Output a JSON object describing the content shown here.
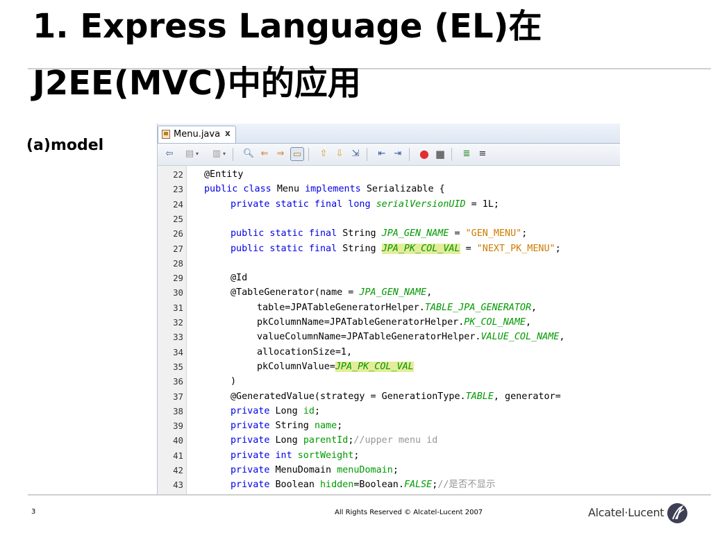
{
  "title": {
    "line1": "1. Express Language (EL)在",
    "line2": "J2EE(MVC)中的应用"
  },
  "subtitle": "(a)model",
  "ide": {
    "tab": {
      "label": "Menu.java",
      "close": "x"
    },
    "code_lines": [
      {
        "n": "22",
        "indent": 0,
        "tokens": [
          [
            "ann",
            "@Entity"
          ]
        ]
      },
      {
        "n": "23",
        "indent": 0,
        "tokens": [
          [
            "kw",
            "public class "
          ],
          [
            "",
            "Menu "
          ],
          [
            "kw",
            "implements "
          ],
          [
            "",
            "Serializable {"
          ]
        ]
      },
      {
        "n": "24",
        "indent": 1,
        "tokens": [
          [
            "kw",
            "private static final long "
          ],
          [
            "sfld",
            "serialVersionUID"
          ],
          [
            "",
            " = 1L;"
          ]
        ]
      },
      {
        "n": "25",
        "indent": 0,
        "tokens": []
      },
      {
        "n": "26",
        "indent": 1,
        "tokens": [
          [
            "kw",
            "public static final "
          ],
          [
            "",
            "String "
          ],
          [
            "sfld",
            "JPA_GEN_NAME"
          ],
          [
            "",
            " = "
          ],
          [
            "str",
            "\"GEN_MENU\""
          ],
          [
            "",
            ";"
          ]
        ]
      },
      {
        "n": "27",
        "indent": 1,
        "tokens": [
          [
            "kw",
            "public static final "
          ],
          [
            "",
            "String "
          ],
          [
            "sfld hl",
            "JPA_PK_COL_VAL"
          ],
          [
            "",
            " = "
          ],
          [
            "str",
            "\"NEXT_PK_MENU\""
          ],
          [
            "",
            ";"
          ]
        ]
      },
      {
        "n": "28",
        "indent": 0,
        "tokens": []
      },
      {
        "n": "29",
        "indent": 1,
        "tokens": [
          [
            "ann",
            "@Id"
          ]
        ]
      },
      {
        "n": "30",
        "indent": 1,
        "tokens": [
          [
            "",
            "@TableGenerator(name = "
          ],
          [
            "sfld",
            "JPA_GEN_NAME"
          ],
          [
            "",
            ","
          ]
        ]
      },
      {
        "n": "31",
        "indent": 2,
        "tokens": [
          [
            "",
            "table=JPATableGeneratorHelper."
          ],
          [
            "sfld",
            "TABLE_JPA_GENERATOR"
          ],
          [
            "",
            ","
          ]
        ]
      },
      {
        "n": "32",
        "indent": 2,
        "tokens": [
          [
            "",
            "pkColumnName=JPATableGeneratorHelper."
          ],
          [
            "sfld",
            "PK_COL_NAME"
          ],
          [
            "",
            ","
          ]
        ]
      },
      {
        "n": "33",
        "indent": 2,
        "tokens": [
          [
            "",
            "valueColumnName=JPATableGeneratorHelper."
          ],
          [
            "sfld",
            "VALUE_COL_NAME"
          ],
          [
            "",
            ","
          ]
        ]
      },
      {
        "n": "34",
        "indent": 2,
        "tokens": [
          [
            "",
            "allocationSize=1,"
          ]
        ]
      },
      {
        "n": "35",
        "indent": 2,
        "tokens": [
          [
            "",
            "pkColumnValue="
          ],
          [
            "sfld hl",
            "JPA_PK_COL_VAL"
          ]
        ]
      },
      {
        "n": "36",
        "indent": 1,
        "tokens": [
          [
            "",
            ")"
          ]
        ]
      },
      {
        "n": "37",
        "indent": 1,
        "tokens": [
          [
            "",
            "@GeneratedValue(strategy = GenerationType."
          ],
          [
            "sfld",
            "TABLE"
          ],
          [
            "",
            ", generator="
          ]
        ]
      },
      {
        "n": "38",
        "indent": 1,
        "tokens": [
          [
            "kw",
            "private "
          ],
          [
            "",
            "Long "
          ],
          [
            "fld",
            "id"
          ],
          [
            "",
            ";"
          ]
        ]
      },
      {
        "n": "39",
        "indent": 1,
        "tokens": [
          [
            "kw",
            "private "
          ],
          [
            "",
            "String "
          ],
          [
            "fld",
            "name"
          ],
          [
            "",
            ";"
          ]
        ]
      },
      {
        "n": "40",
        "indent": 1,
        "tokens": [
          [
            "kw",
            "private "
          ],
          [
            "",
            "Long "
          ],
          [
            "fld",
            "parentId"
          ],
          [
            "",
            ";"
          ],
          [
            "cmt",
            "//upper menu id"
          ]
        ]
      },
      {
        "n": "41",
        "indent": 1,
        "tokens": [
          [
            "kw",
            "private int "
          ],
          [
            "fld",
            "sortWeight"
          ],
          [
            "",
            ";"
          ]
        ]
      },
      {
        "n": "42",
        "indent": 1,
        "tokens": [
          [
            "kw",
            "private "
          ],
          [
            "",
            "MenuDomain "
          ],
          [
            "fld",
            "menuDomain"
          ],
          [
            "",
            ";"
          ]
        ]
      },
      {
        "n": "43",
        "indent": 1,
        "tokens": [
          [
            "kw",
            "private "
          ],
          [
            "",
            "Boolean "
          ],
          [
            "fld",
            "hidden"
          ],
          [
            "",
            "=Boolean."
          ],
          [
            "sfld",
            "FALSE"
          ],
          [
            "",
            ";"
          ],
          [
            "cmt",
            "//是否不显示"
          ]
        ]
      }
    ]
  },
  "footer": {
    "page_number": "3",
    "copyright": "All Rights Reserved © Alcatel-Lucent 2007",
    "logo_text": "Alcatel·Lucent"
  }
}
